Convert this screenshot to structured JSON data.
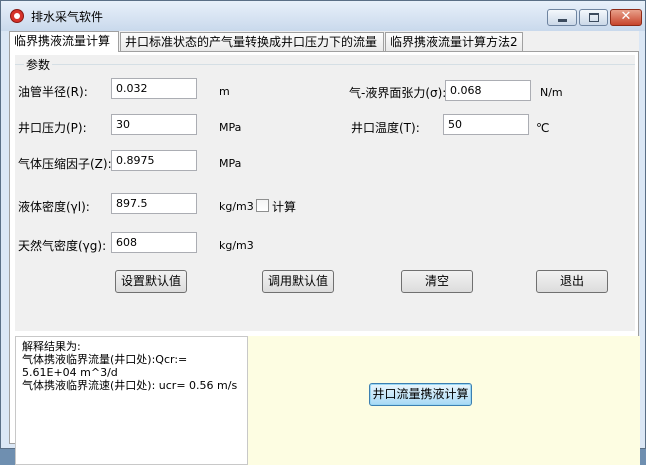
{
  "window": {
    "title": "排水采气软件"
  },
  "tabs": [
    {
      "label": "临界携液流量计算"
    },
    {
      "label": "井口标准状态的产气量转换成井口压力下的流量"
    },
    {
      "label": "临界携液流量计算方法2"
    }
  ],
  "params": {
    "group_title": "参数",
    "tubing_radius": {
      "label": "油管半径(R):",
      "value": "0.032",
      "unit": "m"
    },
    "surface_tension": {
      "label": "气-液界面张力(σ):",
      "value": "0.068",
      "unit": "N/m"
    },
    "wellhead_pressure": {
      "label": "井口压力(P):",
      "value": "30",
      "unit": "MPa"
    },
    "wellhead_temp": {
      "label": "井口温度(T):",
      "value": "50",
      "unit": "℃"
    },
    "gas_z": {
      "label": "气体压缩因子(Z):",
      "value": "0.8975",
      "unit": "MPa"
    },
    "liquid_density": {
      "label": "液体密度(γl):",
      "value": "897.5",
      "unit": "kg/m3",
      "checkbox_label": "计算"
    },
    "gas_density": {
      "label": "天然气密度(γg):",
      "value": "608",
      "unit": "kg/m3"
    }
  },
  "buttons": {
    "set_default": "设置默认值",
    "load_default": "调用默认值",
    "clear": "清空",
    "exit": "退出",
    "calc": "井口流量携液计算"
  },
  "result": {
    "line1": "解释结果为:",
    "line2": "气体携液临界流量(井口处):Qcr:=",
    "line3": "5.61E+04 m^3/d",
    "line4": "气体携液临界流速(井口处): ucr= 0.56 m/s"
  }
}
